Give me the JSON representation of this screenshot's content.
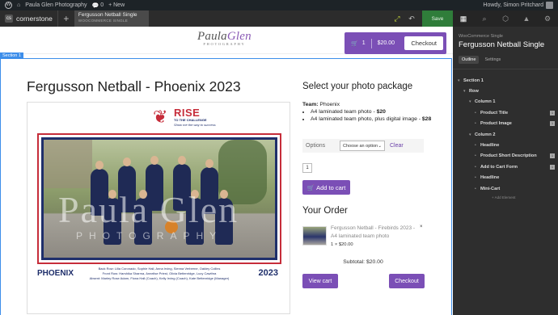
{
  "wp_bar": {
    "site_name": "Paula Glen Photography",
    "comments_count": "0",
    "new_label": "+ New",
    "greeting": "Howdy, Simon Pritchard"
  },
  "cs_bar": {
    "brand": "cornerstone",
    "plus": "+",
    "tab_title": "Fergusson Netball Single",
    "tab_subtitle": "WOOCOMMERCE SINGLE",
    "save_label": "Save",
    "colors": {
      "bar": "#2c2c2c",
      "save": "#2f7d3a",
      "highlight": "#c6d83a"
    }
  },
  "site": {
    "logo_main_a": "Paula",
    "logo_main_b": "Glen",
    "logo_sub": "PHOTOGRAPHY",
    "cart_count": "1",
    "cart_total": "$20.00",
    "cart_checkout": "Checkout",
    "accent": "#7b4fb6"
  },
  "section_label": "Section 1",
  "product": {
    "title": "Fergusson Netball - Phoenix 2023",
    "image": {
      "logo_word": "RISE",
      "logo_sub": "TO THE CHALLENGE",
      "logo_sub2": "Show me the way to success",
      "watermark": "Paula Glen",
      "watermark_sub": "PHOTOGRAPHY",
      "team_name": "PHOENIX",
      "year": "2023",
      "back_row": "Back Row: Lilia Coronado, Sophie Hall, Anna Irving, Sienna Verberne, Oakley Collins",
      "front_row": "Front Row: Harshika Sharma, Annelise Priest, Olivia Bettenridge, Lucy Cawthra",
      "absent": "Absent: Marley Rose Adam, Fiona Hall (Coach), Kelly Irving (Coach), Kate Bettenridge (Manager)"
    },
    "package_heading": "Select your photo package",
    "team_label": "Team:",
    "team_value": "Phoenix",
    "package_items": [
      {
        "text": "A4 laminated team photo - ",
        "price": "$20"
      },
      {
        "text": "A4 laminated team photo, plus digital image - ",
        "price": "$28"
      }
    ],
    "options_label": "Options",
    "options_select": "Choose an option",
    "clear_label": "Clear",
    "quantity": "1",
    "add_to_cart": "Add to cart"
  },
  "order": {
    "heading": "Your Order",
    "item_title": "Fergusson Netball - Firebirds 2023 - A4 laminated team photo",
    "item_qty_price": "1 × $20.00",
    "remove": "×",
    "subtotal": "Subtotal: $20.00",
    "view_cart": "View cart",
    "checkout": "Checkout"
  },
  "panel": {
    "breadcrumb": "WooCommerce Single",
    "title": "Fergusson Netball Single",
    "tabs": [
      "Outline",
      "Settings"
    ],
    "tree": [
      {
        "label": "Section 1",
        "depth": 0,
        "badge": ""
      },
      {
        "label": "Row",
        "depth": 1,
        "badge": ""
      },
      {
        "label": "Column 1",
        "depth": 2,
        "badge": ""
      },
      {
        "label": "Product Title",
        "depth": 3,
        "badge": "1"
      },
      {
        "label": "Product Image",
        "depth": 3,
        "badge": "1"
      },
      {
        "label": "Column 2",
        "depth": 2,
        "badge": ""
      },
      {
        "label": "Headline",
        "depth": 3,
        "badge": ""
      },
      {
        "label": "Product Short Description",
        "depth": 3,
        "badge": "1"
      },
      {
        "label": "Add to Cart Form",
        "depth": 3,
        "badge": "1"
      },
      {
        "label": "Headline",
        "depth": 3,
        "badge": ""
      },
      {
        "label": "Mini-Cart",
        "depth": 3,
        "badge": ""
      }
    ],
    "add_element": "+ Add Element"
  }
}
